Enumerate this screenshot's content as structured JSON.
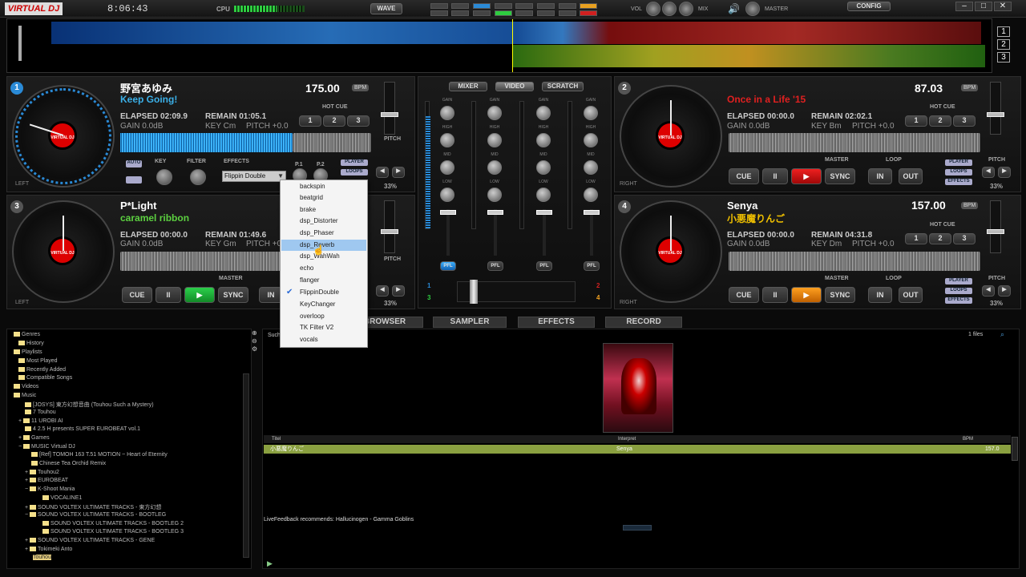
{
  "app": {
    "logo": "VIRTUAL DJ",
    "clock": "8:06:43",
    "cpu_label": "CPU",
    "wave_btn": "WAVE",
    "vol_label": "VOL",
    "mix_label": "MIX",
    "master_label": "MASTER",
    "config_btn": "CONFIG",
    "win_min": "–",
    "win_max": "□",
    "win_close": "✕"
  },
  "overview": {
    "nums": [
      "1",
      "2",
      "3"
    ]
  },
  "deck1": {
    "num": "1",
    "artist": "野宮あゆみ",
    "title": "Keep Going!",
    "bpm": "175.00",
    "bpm_tag": "BPM",
    "elapsed": "ELAPSED 02:09.9",
    "remain": "REMAIN 01:05.1",
    "gain": "GAIN 0.0dB",
    "key": "KEY Cm",
    "pitch": "PITCH +0.0",
    "hotcue": "HOT CUE",
    "hc": [
      "1",
      "2",
      "3"
    ],
    "effects": "EFFECTS",
    "key_lbl": "KEY",
    "filter_lbl": "FILTER",
    "fx_select": "Flippin Double",
    "auto": "AUTO",
    "side": "LEFT",
    "pitch_lbl": "PITCH",
    "pitch_pct": "33%",
    "p1": "P.1",
    "p2": "P.2",
    "player": "PLAYER",
    "loops": "LOOPS"
  },
  "deck2": {
    "num": "2",
    "artist": "",
    "title": "Once in a Life '15",
    "bpm": "87.03",
    "bpm_tag": "BPM",
    "elapsed": "ELAPSED 00:00.0",
    "remain": "REMAIN 02:02.1",
    "gain": "GAIN 0.0dB",
    "key": "KEY Bm",
    "pitch": "PITCH +0.0",
    "hotcue": "HOT CUE",
    "hc": [
      "1",
      "2",
      "3"
    ],
    "master": "MASTER",
    "loop": "LOOP",
    "cue": "CUE",
    "pause": "II",
    "play": "▶",
    "sync": "SYNC",
    "in": "IN",
    "out": "OUT",
    "player": "PLAYER",
    "loops": "LOOPS",
    "effects": "EFFECTS",
    "side": "RIGHT",
    "pitch_lbl": "PITCH",
    "pitch_pct": "33%"
  },
  "deck3": {
    "num": "3",
    "artist": "P*Light",
    "title": "caramel ribbon",
    "elapsed": "ELAPSED 00:00.0",
    "remain": "REMAIN 01:49.6",
    "gain": "GAIN 0.0dB",
    "key": "KEY Gm",
    "pitch": "PITCH +0.0",
    "master": "MASTER",
    "cue": "CUE",
    "pause": "II",
    "play": "▶",
    "sync": "SYNC",
    "in": "IN",
    "side": "LEFT",
    "pitch_lbl": "PITCH",
    "pitch_pct": "33%"
  },
  "deck4": {
    "num": "4",
    "artist": "Senya",
    "title": "小悪魔りんご",
    "bpm": "157.00",
    "bpm_tag": "BPM",
    "elapsed": "ELAPSED 00:00.0",
    "remain": "REMAIN 04:31.8",
    "gain": "GAIN 0.0dB",
    "key": "KEY Dm",
    "pitch": "PITCH +0.0",
    "hotcue": "HOT CUE",
    "hc": [
      "1",
      "2",
      "3"
    ],
    "master": "MASTER",
    "loop": "LOOP",
    "cue": "CUE",
    "pause": "II",
    "play": "▶",
    "sync": "SYNC",
    "in": "IN",
    "out": "OUT",
    "player": "PLAYER",
    "loops": "LOOPS",
    "effects": "EFFECTS",
    "side": "RIGHT",
    "pitch_lbl": "PITCH",
    "pitch_pct": "33%"
  },
  "mixer": {
    "tabs": [
      "MIXER",
      "VIDEO",
      "SCRATCH"
    ],
    "eq": [
      "GAIN",
      "HIGH",
      "MID",
      "LOW"
    ],
    "pfl": "PFL",
    "xf_left": [
      "1",
      "3"
    ],
    "xf_right": [
      "2",
      "4"
    ]
  },
  "browser_tabs": [
    "BROWSER",
    "SAMPLER",
    "EFFECTS",
    "RECORD"
  ],
  "fx_menu": {
    "items": [
      "backspin",
      "beatgrid",
      "brake",
      "dsp_Distorter",
      "dsp_Phaser",
      "dsp_Reverb",
      "dsp_WahWah",
      "echo",
      "flanger",
      "FlippinDouble",
      "KeyChanger",
      "overloop",
      "TK Filter V2",
      "vocals"
    ],
    "checked": "FlippinDouble",
    "highlighted": "dsp_Reverb"
  },
  "tree": {
    "items": [
      "Genres",
      "History",
      "Playlists",
      "Most Played",
      "Recently Added",
      "Compatible Songs",
      "Videos",
      "Music",
      "[JOSYS] 東方幻想音曲 (Touhou Such a Mystery)",
      "7 Touhou",
      "11 UROBI AI",
      "4 2.5 H presents SUPER EUROBEAT vol.1",
      "Games",
      "MUSIC Virtual DJ",
      "[Ref] TOMOH 163 T.51 MOTION ~ Heart of Eternity",
      "Chinese Tea Orchid Remix",
      "Touhou2",
      "EUROBEAT",
      "K-Shoot Mania",
      "VOCALINE1",
      "SOUND VOLTEX ULTIMATE TRACKS - 東方幻想",
      "SOUND VOLTEX ULTIMATE TRACKS - BOOTLEG",
      "SOUND VOLTEX ULTIMATE TRACKS - BOOTLEG 2",
      "SOUND VOLTEX ULTIMATE TRACKS - BOOTLEG 3",
      "SOUND VOLTEX ULTIMATE TRACKS - GENE",
      "Tokimeki Anto",
      "Touhou"
    ]
  },
  "browser": {
    "search_label": "Such",
    "files": "1 files",
    "col_title": "Titel",
    "col_artist": "Interpret",
    "col_bpm": "BPM",
    "row_title": "小悪魔りんご",
    "row_artist": "Senya",
    "row_bpm": "157.0",
    "feedback": "LiveFeedback recommends: Hallucinogen - Gamma Goblins"
  }
}
